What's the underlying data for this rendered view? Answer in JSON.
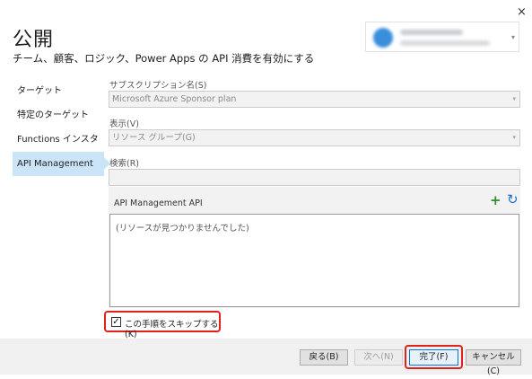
{
  "window": {
    "close_glyph": "×"
  },
  "header": {
    "title": "公開",
    "subtitle": "チーム、顧客、ロジック、Power Apps の API 消費を有効にする"
  },
  "nav": {
    "items": [
      {
        "label": "ターゲット"
      },
      {
        "label": "特定のターゲット"
      },
      {
        "label": "Functions インスタンス"
      },
      {
        "label": "API Management"
      }
    ]
  },
  "form": {
    "subscription_label": "サブスクリプション名(S)",
    "subscription_value": "Microsoft Azure Sponsor plan",
    "view_label": "表示(V)",
    "view_value": "リソース グループ(G)",
    "search_label": "検索(R)",
    "search_value": "",
    "api_title": "API Management API",
    "api_empty": "(リソースが見つかりませんでした)",
    "skip_label": "この手順をスキップする(K)",
    "skip_checked": true
  },
  "footer": {
    "back_label": "戻る(B)",
    "next_label": "次へ(N)",
    "finish_label": "完了(F)",
    "cancel_label": "キャンセル(C)"
  },
  "icons": {
    "plus": "+",
    "refresh": "↻",
    "check": "✓",
    "dropdown": "▾"
  },
  "colors": {
    "accent": "#0078d7",
    "highlight_red": "#e0211c",
    "nav_selected": "#cce4f7"
  }
}
